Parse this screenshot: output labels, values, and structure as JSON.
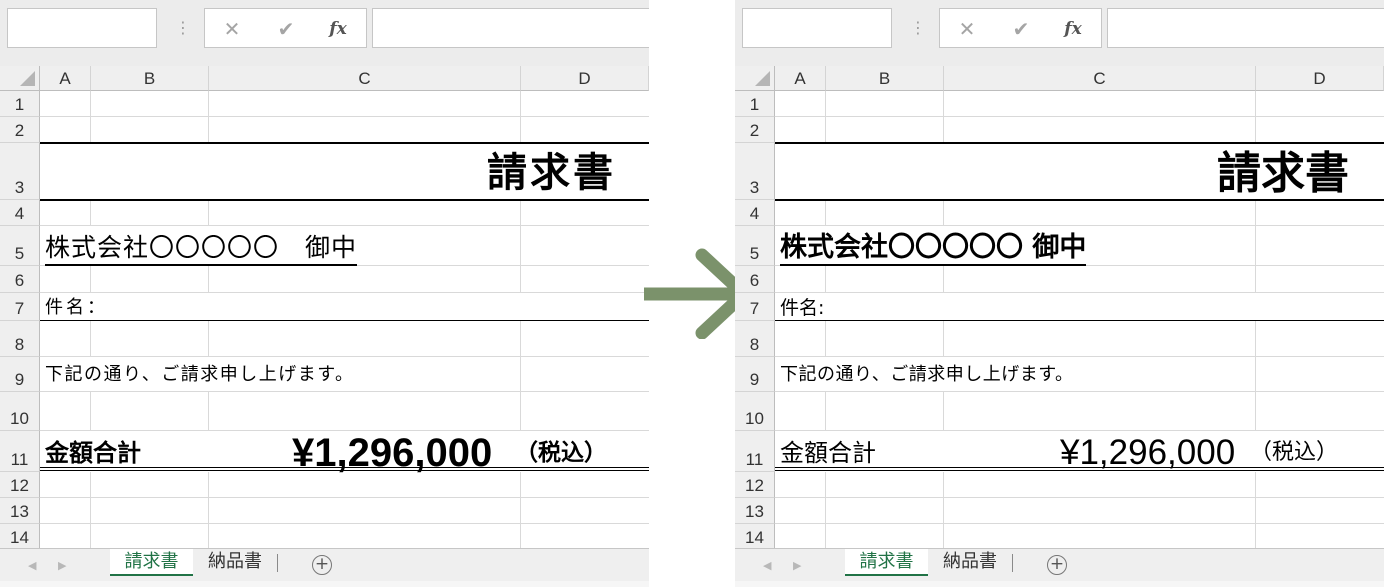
{
  "columns": [
    "A",
    "B",
    "C",
    "D"
  ],
  "rows": [
    "1",
    "2",
    "3",
    "4",
    "5",
    "6",
    "7",
    "8",
    "9",
    "10",
    "11",
    "12",
    "13",
    "14"
  ],
  "formula_bar": {
    "fx_label": "fx",
    "cancel_icon": "x-icon",
    "enter_icon": "checkmark-icon"
  },
  "sheet_tabs": [
    "請求書",
    "納品書"
  ],
  "active_tab": "請求書",
  "accent_color": "#217346",
  "arrow_color": "#7b926b",
  "before": {
    "title": "請求書",
    "recipient": "株式会社〇〇〇〇〇　御中",
    "subject": "件名：",
    "message": "下記の通り、ご請求申し上げます。",
    "total_label": "金額合計",
    "total_value": "¥1,296,000",
    "tax_note": "（税込）"
  },
  "after": {
    "title": "請求書",
    "recipient": "株式会社〇〇〇〇〇 御中",
    "subject": "件名:",
    "message": "下記の通り、ご請求申し上げます。",
    "total_label": "金額合計",
    "total_value": "¥1,296,000",
    "tax_note": "（税込）"
  }
}
